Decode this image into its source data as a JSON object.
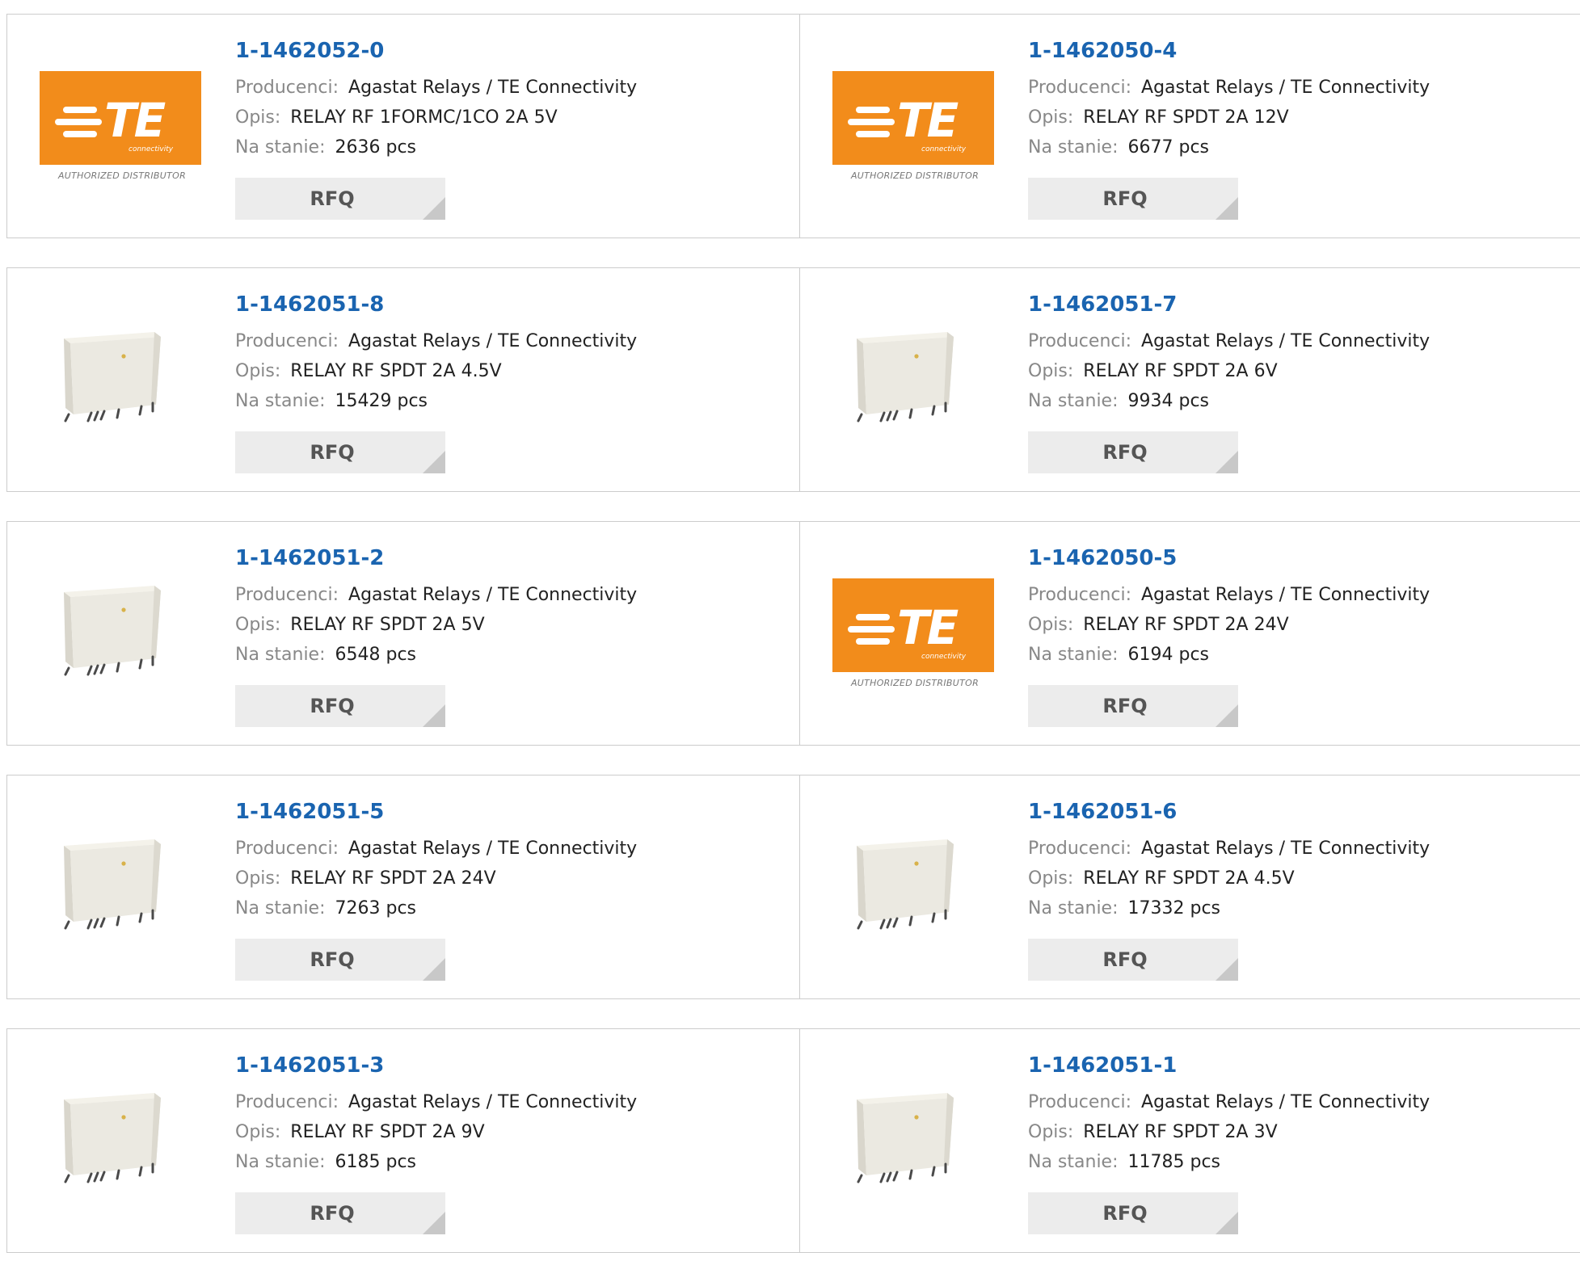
{
  "labels": {
    "manufacturer": "Producenci:",
    "description": "Opis:",
    "stock": "Na stanie:",
    "rfq": "RFQ"
  },
  "logo": {
    "text": "TE",
    "sub": "connectivity",
    "caption": "AUTHORIZED DISTRIBUTOR",
    "color": "#f28c1b"
  },
  "colors": {
    "part_link": "#1a64b0",
    "label_gray": "#888888",
    "rfq_bg": "#ececec"
  },
  "products": [
    {
      "part": "1-1462052-0",
      "image": "te-logo",
      "manufacturer": "Agastat Relays / TE Connectivity",
      "description": "RELAY RF 1FORMC/1CO 2A 5V",
      "stock": "2636 pcs"
    },
    {
      "part": "1-1462050-4",
      "image": "te-logo",
      "manufacturer": "Agastat Relays / TE Connectivity",
      "description": "RELAY RF SPDT 2A 12V",
      "stock": "6677 pcs"
    },
    {
      "part": "1-1462051-8",
      "image": "relay",
      "manufacturer": "Agastat Relays / TE Connectivity",
      "description": "RELAY RF SPDT 2A 4.5V",
      "stock": "15429 pcs"
    },
    {
      "part": "1-1462051-7",
      "image": "relay",
      "manufacturer": "Agastat Relays / TE Connectivity",
      "description": "RELAY RF SPDT 2A 6V",
      "stock": "9934 pcs"
    },
    {
      "part": "1-1462051-2",
      "image": "relay",
      "manufacturer": "Agastat Relays / TE Connectivity",
      "description": "RELAY RF SPDT 2A 5V",
      "stock": "6548 pcs"
    },
    {
      "part": "1-1462050-5",
      "image": "te-logo",
      "manufacturer": "Agastat Relays / TE Connectivity",
      "description": "RELAY RF SPDT 2A 24V",
      "stock": "6194 pcs"
    },
    {
      "part": "1-1462051-5",
      "image": "relay",
      "manufacturer": "Agastat Relays / TE Connectivity",
      "description": "RELAY RF SPDT 2A 24V",
      "stock": "7263 pcs"
    },
    {
      "part": "1-1462051-6",
      "image": "relay",
      "manufacturer": "Agastat Relays / TE Connectivity",
      "description": "RELAY RF SPDT 2A 4.5V",
      "stock": "17332 pcs"
    },
    {
      "part": "1-1462051-3",
      "image": "relay",
      "manufacturer": "Agastat Relays / TE Connectivity",
      "description": "RELAY RF SPDT 2A 9V",
      "stock": "6185 pcs"
    },
    {
      "part": "1-1462051-1",
      "image": "relay",
      "manufacturer": "Agastat Relays / TE Connectivity",
      "description": "RELAY RF SPDT 2A 3V",
      "stock": "11785 pcs"
    }
  ]
}
